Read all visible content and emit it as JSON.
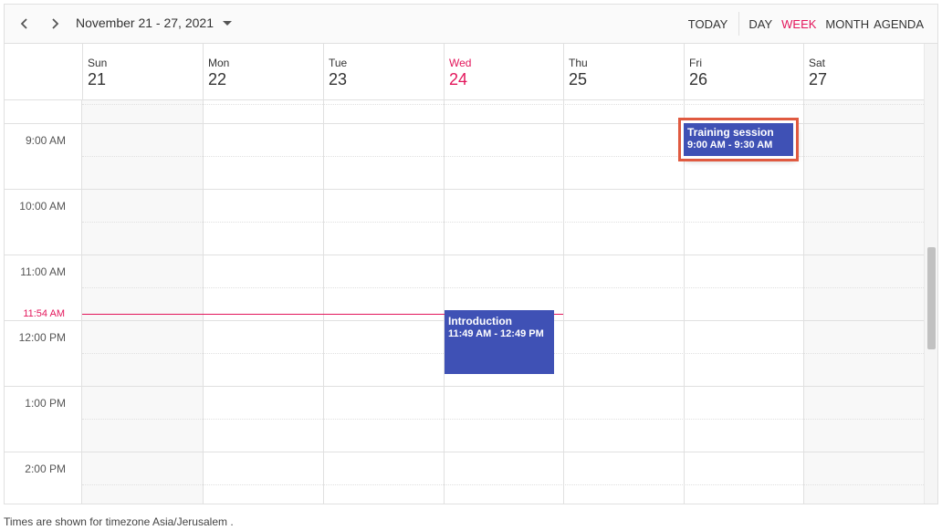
{
  "toolbar": {
    "prev_icon": "chevron-left-icon",
    "next_icon": "chevron-right-icon",
    "date_range": "November 21 - 27, 2021",
    "dropdown_icon": "caret-down-icon",
    "views": {
      "today": "TODAY",
      "day": "DAY",
      "week": "WEEK",
      "month": "MONTH",
      "agenda": "AGENDA"
    },
    "active_view": "week"
  },
  "days": [
    {
      "name": "Sun",
      "num": "21"
    },
    {
      "name": "Mon",
      "num": "22"
    },
    {
      "name": "Tue",
      "num": "23"
    },
    {
      "name": "Wed",
      "num": "24"
    },
    {
      "name": "Thu",
      "num": "25"
    },
    {
      "name": "Fri",
      "num": "26"
    },
    {
      "name": "Sat",
      "num": "27"
    }
  ],
  "today_index": 3,
  "time_labels": [
    "9:00 AM",
    "10:00 AM",
    "11:00 AM",
    "12:00 PM",
    "1:00 PM",
    "2:00 PM"
  ],
  "current_time": "11:54 AM",
  "events": [
    {
      "title": "Training session",
      "time": "9:00 AM - 9:30 AM",
      "day": "Fri",
      "selected": true
    },
    {
      "title": "Introduction",
      "time": "11:49 AM - 12:49 PM",
      "day": "Wed",
      "selected": false
    }
  ],
  "footer": "Times are shown for timezone Asia/Jerusalem .",
  "colors": {
    "accent": "#e3165b",
    "event": "#3f51b5",
    "selection_border": "#e05a40",
    "grid_line": "#e0e0e0"
  }
}
